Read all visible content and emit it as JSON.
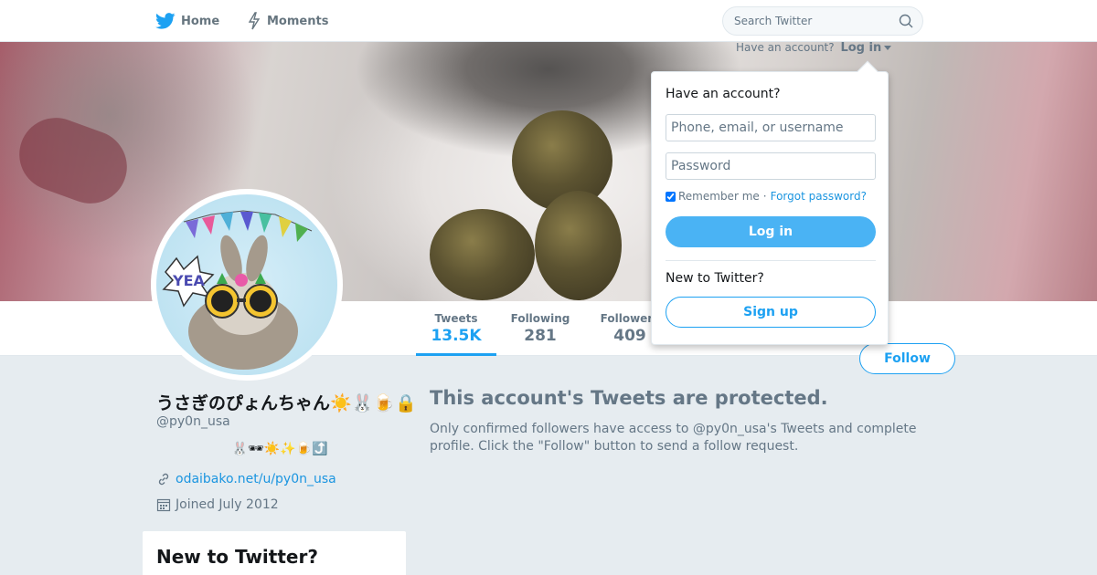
{
  "nav": {
    "home_label": "Home",
    "moments_label": "Moments",
    "search_placeholder": "Search Twitter"
  },
  "login_prompt": {
    "text": "Have an account?",
    "link_label": "Log in"
  },
  "login_dropdown": {
    "title": "Have an account?",
    "username_placeholder": "Phone, email, or username",
    "password_placeholder": "Password",
    "remember_label": "Remember me",
    "separator": "·",
    "forgot_label": "Forgot password?",
    "login_button": "Log in",
    "new_title": "New to Twitter?",
    "signup_button": "Sign up"
  },
  "stats": [
    {
      "label": "Tweets",
      "value": "13.5K"
    },
    {
      "label": "Following",
      "value": "281"
    },
    {
      "label": "Followers",
      "value": "409"
    }
  ],
  "follow_button": "Follow",
  "profile": {
    "name": "うさぎのぴょんちゃん☀️🐰🍺🔒",
    "handle": "@py0n_usa",
    "bio": "🐰🕶☀️✨🍺⤴️",
    "link": "odaibako.net/u/py0n_usa",
    "joined": "Joined July 2012"
  },
  "protected": {
    "title": "This account's Tweets are protected.",
    "text": "Only confirmed followers have access to @py0n_usa's Tweets and complete profile. Click the \"Follow\" button to send a follow request."
  },
  "sidebar_card": {
    "title": "New to Twitter?"
  },
  "colors": {
    "brand": "#1da1f2",
    "link": "#1b95e0",
    "muted": "#657786",
    "background": "#e6ecf0"
  },
  "icons": [
    "twitter-bird-icon",
    "lightning-icon",
    "search-icon",
    "caret-down-icon",
    "link-icon",
    "calendar-icon"
  ]
}
